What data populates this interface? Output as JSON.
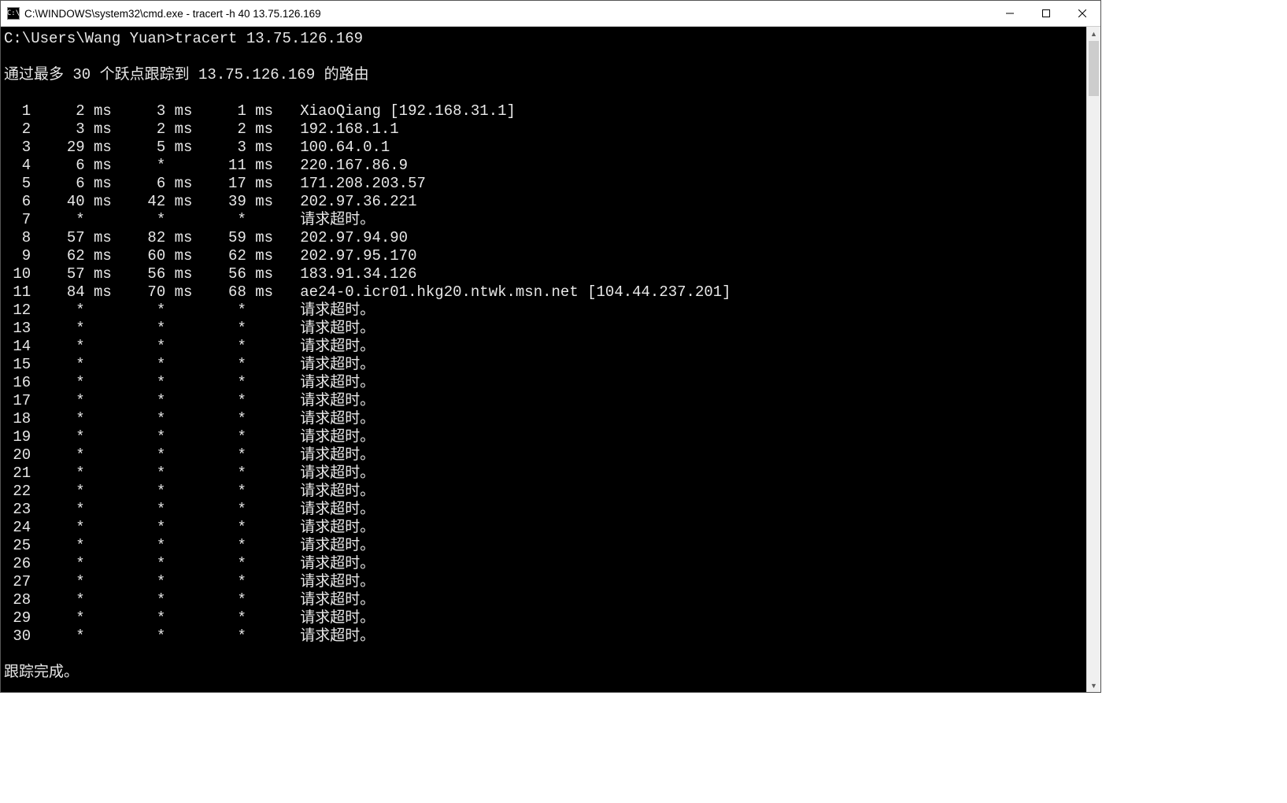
{
  "window": {
    "title": "C:\\WINDOWS\\system32\\cmd.exe - tracert  -h 40 13.75.126.169",
    "icon_label": "C:\\"
  },
  "terminal": {
    "prompt": "C:\\Users\\Wang Yuan>",
    "command": "tracert 13.75.126.169",
    "header": "通过最多 30 个跃点跟踪到 13.75.126.169 的路由",
    "timeout_text": "请求超时。",
    "footer": "跟踪完成。",
    "hops": [
      {
        "n": 1,
        "t1": "2 ms",
        "t2": "3 ms",
        "t3": "1 ms",
        "host": "XiaoQiang [192.168.31.1]"
      },
      {
        "n": 2,
        "t1": "3 ms",
        "t2": "2 ms",
        "t3": "2 ms",
        "host": "192.168.1.1"
      },
      {
        "n": 3,
        "t1": "29 ms",
        "t2": "5 ms",
        "t3": "3 ms",
        "host": "100.64.0.1"
      },
      {
        "n": 4,
        "t1": "6 ms",
        "t2": "*",
        "t3": "11 ms",
        "host": "220.167.86.9"
      },
      {
        "n": 5,
        "t1": "6 ms",
        "t2": "6 ms",
        "t3": "17 ms",
        "host": "171.208.203.57"
      },
      {
        "n": 6,
        "t1": "40 ms",
        "t2": "42 ms",
        "t3": "39 ms",
        "host": "202.97.36.221"
      },
      {
        "n": 7,
        "t1": "*",
        "t2": "*",
        "t3": "*",
        "host": "请求超时。"
      },
      {
        "n": 8,
        "t1": "57 ms",
        "t2": "82 ms",
        "t3": "59 ms",
        "host": "202.97.94.90"
      },
      {
        "n": 9,
        "t1": "62 ms",
        "t2": "60 ms",
        "t3": "62 ms",
        "host": "202.97.95.170"
      },
      {
        "n": 10,
        "t1": "57 ms",
        "t2": "56 ms",
        "t3": "56 ms",
        "host": "183.91.34.126"
      },
      {
        "n": 11,
        "t1": "84 ms",
        "t2": "70 ms",
        "t3": "68 ms",
        "host": "ae24-0.icr01.hkg20.ntwk.msn.net [104.44.237.201]"
      },
      {
        "n": 12,
        "t1": "*",
        "t2": "*",
        "t3": "*",
        "host": "请求超时。"
      },
      {
        "n": 13,
        "t1": "*",
        "t2": "*",
        "t3": "*",
        "host": "请求超时。"
      },
      {
        "n": 14,
        "t1": "*",
        "t2": "*",
        "t3": "*",
        "host": "请求超时。"
      },
      {
        "n": 15,
        "t1": "*",
        "t2": "*",
        "t3": "*",
        "host": "请求超时。"
      },
      {
        "n": 16,
        "t1": "*",
        "t2": "*",
        "t3": "*",
        "host": "请求超时。"
      },
      {
        "n": 17,
        "t1": "*",
        "t2": "*",
        "t3": "*",
        "host": "请求超时。"
      },
      {
        "n": 18,
        "t1": "*",
        "t2": "*",
        "t3": "*",
        "host": "请求超时。"
      },
      {
        "n": 19,
        "t1": "*",
        "t2": "*",
        "t3": "*",
        "host": "请求超时。"
      },
      {
        "n": 20,
        "t1": "*",
        "t2": "*",
        "t3": "*",
        "host": "请求超时。"
      },
      {
        "n": 21,
        "t1": "*",
        "t2": "*",
        "t3": "*",
        "host": "请求超时。"
      },
      {
        "n": 22,
        "t1": "*",
        "t2": "*",
        "t3": "*",
        "host": "请求超时。"
      },
      {
        "n": 23,
        "t1": "*",
        "t2": "*",
        "t3": "*",
        "host": "请求超时。"
      },
      {
        "n": 24,
        "t1": "*",
        "t2": "*",
        "t3": "*",
        "host": "请求超时。"
      },
      {
        "n": 25,
        "t1": "*",
        "t2": "*",
        "t3": "*",
        "host": "请求超时。"
      },
      {
        "n": 26,
        "t1": "*",
        "t2": "*",
        "t3": "*",
        "host": "请求超时。"
      },
      {
        "n": 27,
        "t1": "*",
        "t2": "*",
        "t3": "*",
        "host": "请求超时。"
      },
      {
        "n": 28,
        "t1": "*",
        "t2": "*",
        "t3": "*",
        "host": "请求超时。"
      },
      {
        "n": 29,
        "t1": "*",
        "t2": "*",
        "t3": "*",
        "host": "请求超时。"
      },
      {
        "n": 30,
        "t1": "*",
        "t2": "*",
        "t3": "*",
        "host": "请求超时。"
      }
    ]
  }
}
